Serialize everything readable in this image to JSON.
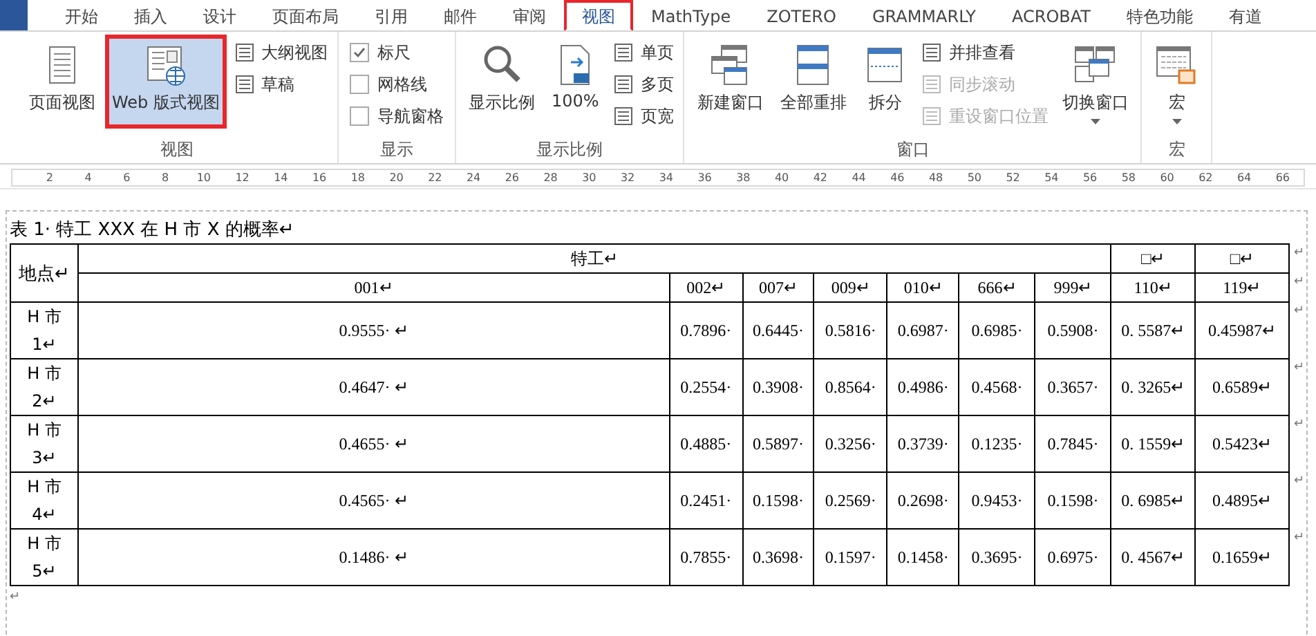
{
  "tabs": [
    {
      "label": "开始",
      "selected": false,
      "annotated": false
    },
    {
      "label": "插入",
      "selected": false,
      "annotated": false
    },
    {
      "label": "设计",
      "selected": false,
      "annotated": false
    },
    {
      "label": "页面布局",
      "selected": false,
      "annotated": false
    },
    {
      "label": "引用",
      "selected": false,
      "annotated": false
    },
    {
      "label": "邮件",
      "selected": false,
      "annotated": false
    },
    {
      "label": "审阅",
      "selected": false,
      "annotated": false
    },
    {
      "label": "视图",
      "selected": true,
      "annotated": true
    },
    {
      "label": "MathType",
      "selected": false,
      "annotated": false
    },
    {
      "label": "ZOTERO",
      "selected": false,
      "annotated": false
    },
    {
      "label": "GRAMMARLY",
      "selected": false,
      "annotated": false
    },
    {
      "label": "ACROBAT",
      "selected": false,
      "annotated": false
    },
    {
      "label": "特色功能",
      "selected": false,
      "annotated": false
    },
    {
      "label": "有道",
      "selected": false,
      "annotated": false
    }
  ],
  "ribbon": {
    "groups": [
      {
        "label": "视图",
        "items": [
          {
            "kind": "large",
            "label": "页面视图",
            "selected": false,
            "annotated": false
          },
          {
            "kind": "large",
            "label": "Web 版式视图",
            "selected": true,
            "annotated": true
          },
          {
            "kind": "stack",
            "items": [
              {
                "label": "大纲视图",
                "disabled": false
              },
              {
                "label": "草稿",
                "disabled": false
              }
            ]
          }
        ]
      },
      {
        "label": "显示",
        "items": [
          {
            "kind": "checks",
            "items": [
              {
                "label": "标尺",
                "checked": true
              },
              {
                "label": "网格线",
                "checked": false
              },
              {
                "label": "导航窗格",
                "checked": false
              }
            ]
          }
        ]
      },
      {
        "label": "显示比例",
        "items": [
          {
            "kind": "large",
            "label": "显示比例",
            "selected": false,
            "annotated": false
          },
          {
            "kind": "large",
            "label": "100%",
            "selected": false,
            "annotated": false
          },
          {
            "kind": "stack",
            "items": [
              {
                "label": "单页",
                "disabled": false
              },
              {
                "label": "多页",
                "disabled": false
              },
              {
                "label": "页宽",
                "disabled": false
              }
            ]
          }
        ]
      },
      {
        "label": "窗口",
        "items": [
          {
            "kind": "large",
            "label": "新建窗口",
            "selected": false,
            "annotated": false
          },
          {
            "kind": "large",
            "label": "全部重排",
            "selected": false,
            "annotated": false
          },
          {
            "kind": "large",
            "label": "拆分",
            "selected": false,
            "annotated": false
          },
          {
            "kind": "stack",
            "items": [
              {
                "label": "并排查看",
                "disabled": false
              },
              {
                "label": "同步滚动",
                "disabled": true
              },
              {
                "label": "重设窗口位置",
                "disabled": true
              }
            ]
          },
          {
            "kind": "large_menu",
            "label": "切换窗口",
            "selected": false,
            "annotated": false
          }
        ]
      },
      {
        "label": "宏",
        "items": [
          {
            "kind": "large_menu",
            "label": "宏",
            "selected": false,
            "annotated": false
          }
        ]
      }
    ]
  },
  "ruler": {
    "ticks": [
      "2",
      "4",
      "6",
      "8",
      "10",
      "12",
      "14",
      "16",
      "18",
      "20",
      "22",
      "24",
      "26",
      "28",
      "30",
      "32",
      "34",
      "36",
      "38",
      "40",
      "42",
      "44",
      "46",
      "48",
      "50",
      "52",
      "54",
      "56",
      "58",
      "60",
      "62",
      "64",
      "66"
    ]
  },
  "document": {
    "caption": "表 1· 特工 XXX 在 H 市 X 的概率↵",
    "table": {
      "header_rows": [
        {
          "cells": [
            {
              "text": "地点↵",
              "rowspan": 2
            },
            {
              "text": "特工↵",
              "colspan": 7
            },
            {
              "text": "□↵"
            },
            {
              "text": "□↵"
            }
          ],
          "end_mark": "↵"
        },
        {
          "cells": [
            {
              "text": "001↵"
            },
            {
              "text": "002↵"
            },
            {
              "text": "007↵"
            },
            {
              "text": "009↵"
            },
            {
              "text": "010↵"
            },
            {
              "text": "666↵"
            },
            {
              "text": "999↵"
            },
            {
              "text": "110↵"
            },
            {
              "text": "119↵"
            }
          ],
          "end_mark": "↵"
        }
      ],
      "rows": [
        {
          "place": "H 市 1↵",
          "values": [
            "0.9555· ↵",
            "0.7896·",
            "0.6445·",
            "0.5816·",
            "0.6987·",
            "0.6985·",
            "0.5908·",
            "0. 5587↵",
            "0.45987↵"
          ],
          "end_mark": "↵"
        },
        {
          "place": "H 市 2↵",
          "values": [
            "0.4647· ↵",
            "0.2554·",
            "0.3908·",
            "0.8564·",
            "0.4986·",
            "0.4568·",
            "0.3657·",
            "0. 3265↵",
            "0.6589↵"
          ],
          "end_mark": "↵"
        },
        {
          "place": "H 市 3↵",
          "values": [
            "0.4655· ↵",
            "0.4885·",
            "0.5897·",
            "0.3256·",
            "0.3739·",
            "0.1235·",
            "0.7845·",
            "0. 1559↵",
            "0.5423↵"
          ],
          "end_mark": "↵"
        },
        {
          "place": "H 市 4↵",
          "values": [
            "0.4565· ↵",
            "0.2451·",
            "0.1598·",
            "0.2569·",
            "0.2698·",
            "0.9453·",
            "0.1598·",
            "0. 6985↵",
            "0.4895↵"
          ],
          "end_mark": "↵"
        },
        {
          "place": "H 市 5↵",
          "values": [
            "0.1486· ↵",
            "0.7855·",
            "0.3698·",
            "0.1597·",
            "0.1458·",
            "0.3695·",
            "0.6975·",
            "0. 4567↵",
            "0.1659↵"
          ],
          "end_mark": "↵"
        }
      ]
    },
    "end_mark": "↵"
  }
}
